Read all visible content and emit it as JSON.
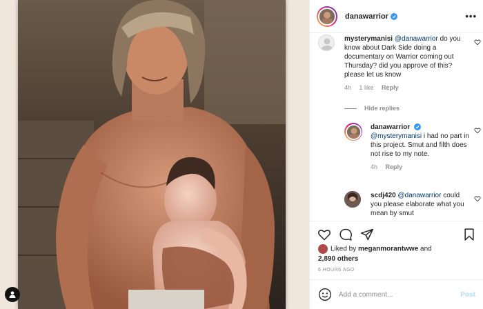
{
  "post": {
    "username": "danawarrior",
    "verified": true,
    "more_label": "•••"
  },
  "comments": [
    {
      "username": "mysterymanisi",
      "mention": "@danawarrior",
      "text": " do you know about Dark Side doing a documentary on Warrior coming out Thursday? did you approve of this? please let us know",
      "age": "4h",
      "likes": "1 like",
      "reply_label": "Reply",
      "avatar": "blank-avatar"
    },
    {
      "username": "danawarrior",
      "mention": "@mysterymanisi",
      "text": " i had no part in this project. Smut and filth does not rise to my note.",
      "age": "4h",
      "reply_label": "Reply",
      "verified": true
    },
    {
      "username": "scdj420",
      "mention": "@danawarrior",
      "text": " could you please elaborate what you mean by smut"
    }
  ],
  "hide_replies_label": "Hide replies",
  "likes": {
    "prefix": "Liked by ",
    "user": "meganmorantwwe",
    "middle": " and",
    "count": "2,890 others"
  },
  "timestamp": "6 HOURS AGO",
  "add_comment": {
    "placeholder": "Add a comment...",
    "post_label": "Post"
  },
  "colors": {
    "accent": "#3897f0",
    "post_disabled": "#b2dffc",
    "muted": "#8e8e8e"
  },
  "icons": {
    "like": "heart-icon",
    "comment": "comment-bubble-icon",
    "share": "paper-plane-icon",
    "save": "bookmark-icon",
    "emoji": "smiley-icon",
    "tags": "user-tag-icon"
  }
}
